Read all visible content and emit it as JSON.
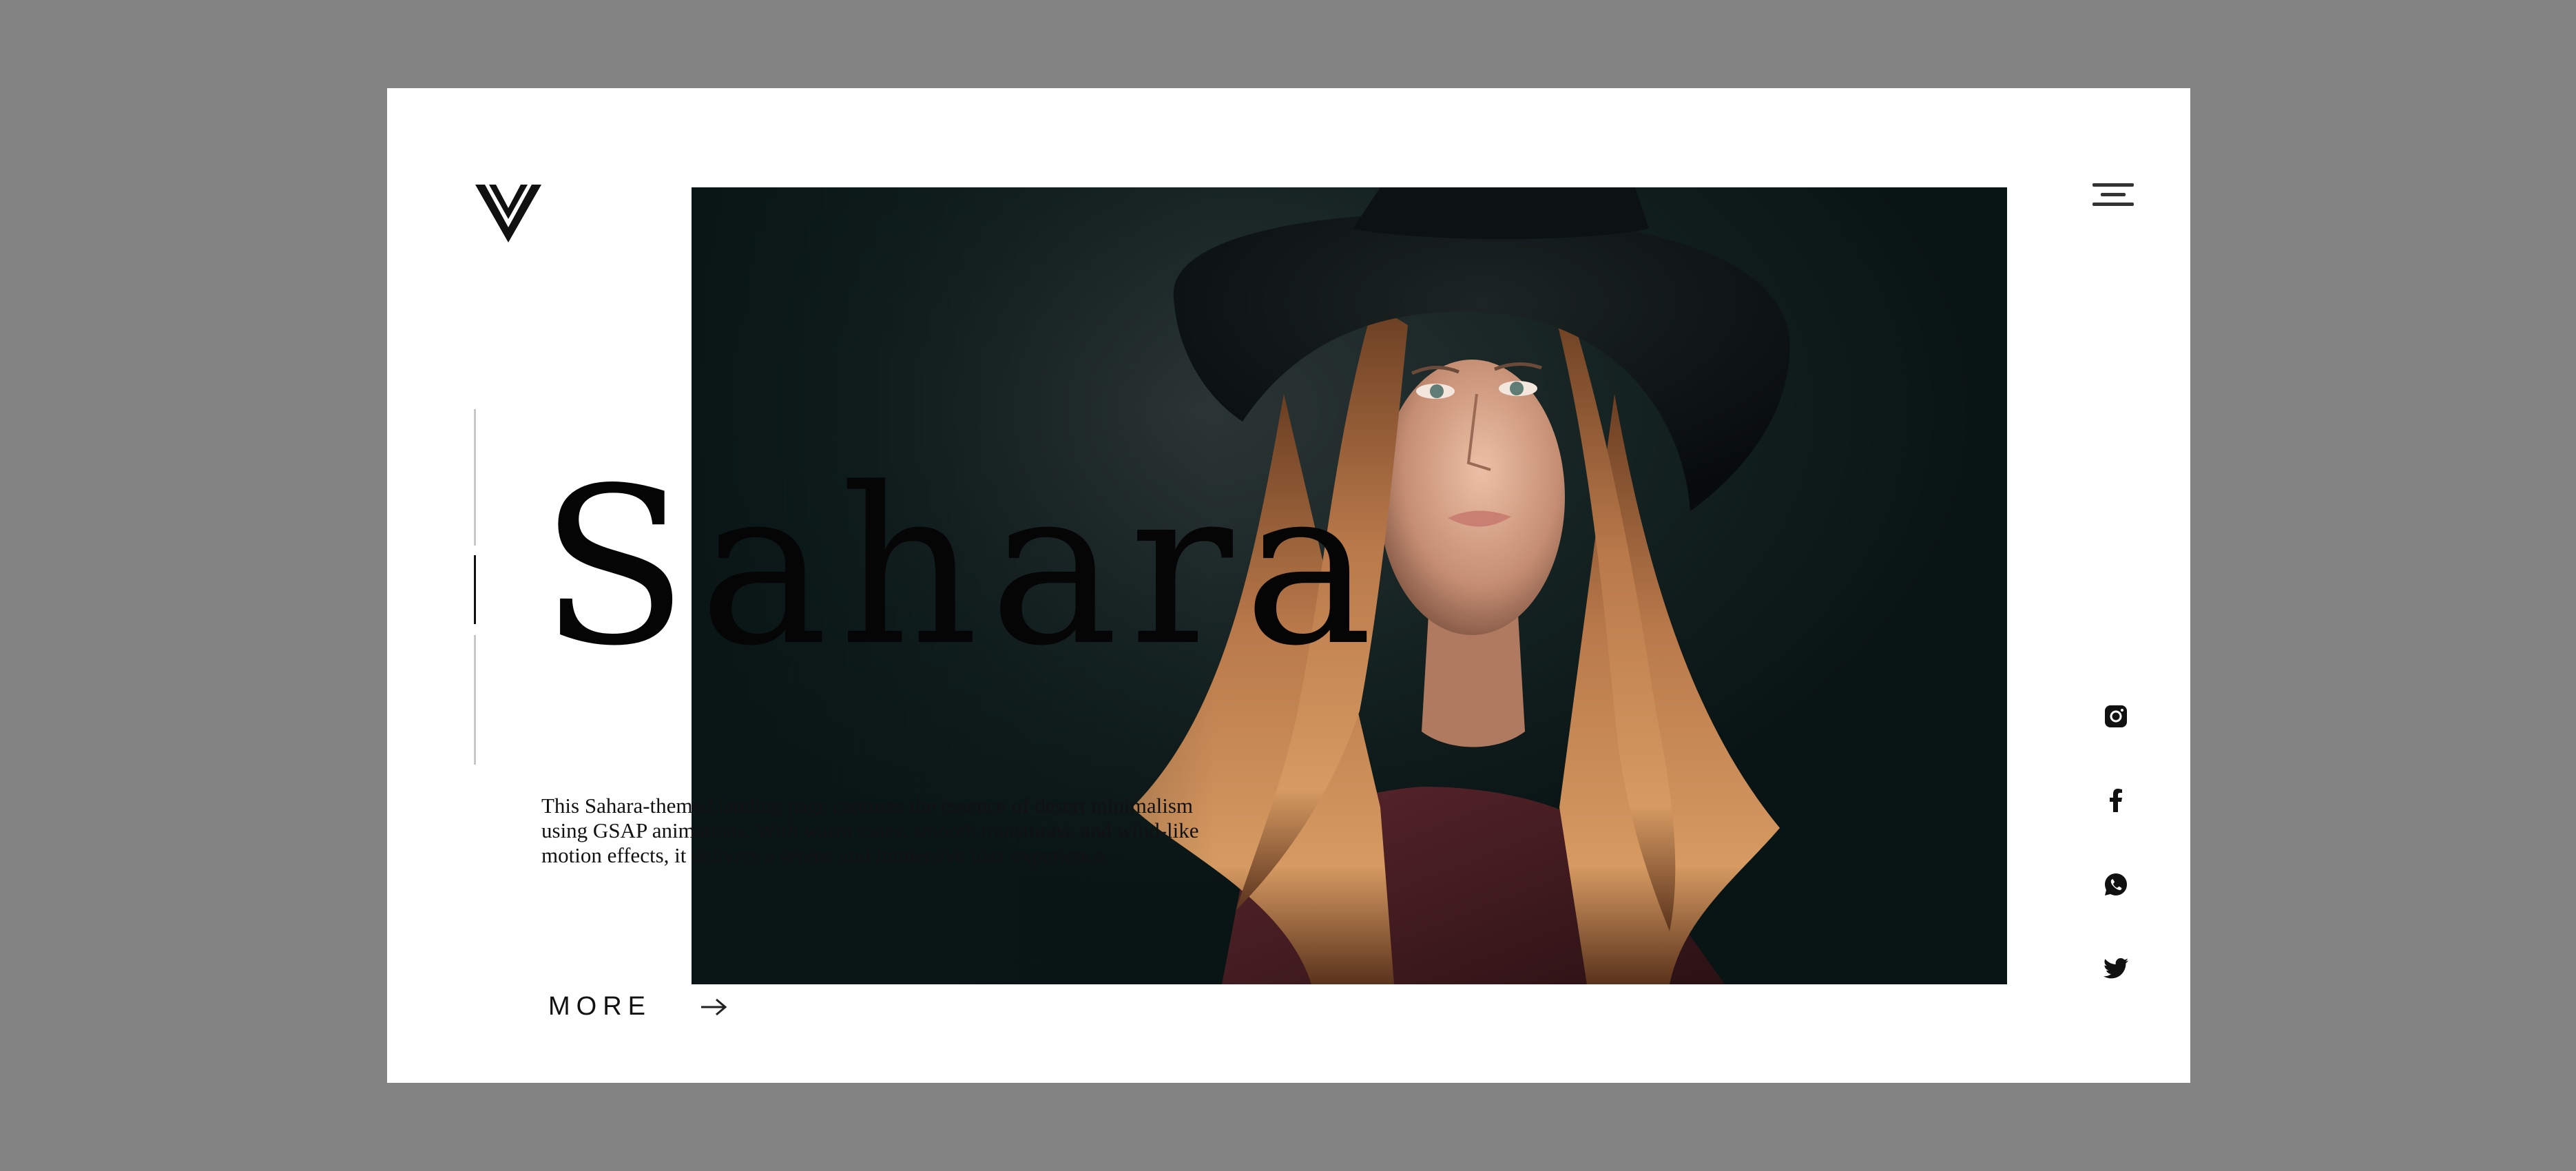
{
  "brand": {
    "logo_icon": "v-chevron-logo-icon"
  },
  "header": {
    "menu_icon": "hamburger-menu-icon"
  },
  "hero": {
    "title": "Sahara",
    "description": "This Sahara-themed landing page captures the essence of desert minimalism using GSAP animations. With warm tones, smooth transitions, and wind-like motion effects, it delivers a serene and immersive user experience.",
    "cta_label": "MORE",
    "cta_icon": "arrow-right-icon",
    "image_subject": "woman-with-black-hat-photo",
    "slides_total": 3,
    "slide_active": 2
  },
  "social": [
    {
      "name": "instagram",
      "icon": "instagram-icon"
    },
    {
      "name": "facebook",
      "icon": "facebook-icon"
    },
    {
      "name": "whatsapp",
      "icon": "whatsapp-icon"
    },
    {
      "name": "twitter",
      "icon": "twitter-icon"
    }
  ],
  "colors": {
    "backdrop": "#838383",
    "card": "#ffffff",
    "text": "#050505",
    "photo_bg": "#0b1717",
    "hair": "#b9794a",
    "sweater": "#4a1f24"
  }
}
